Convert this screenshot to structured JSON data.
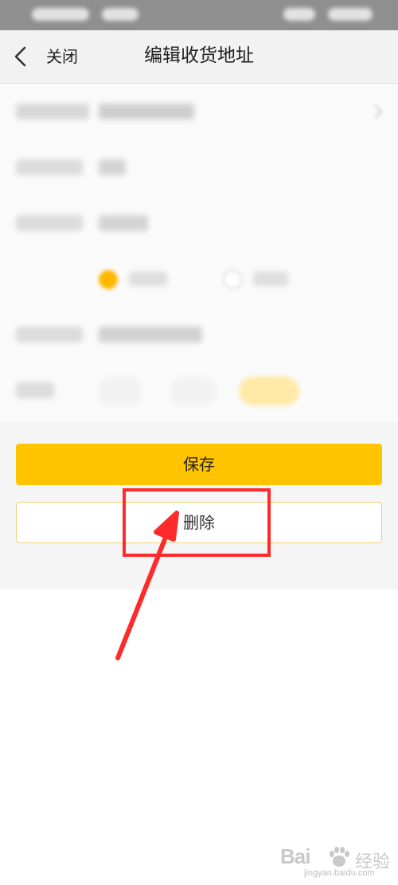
{
  "header": {
    "close_label": "关闭",
    "title": "编辑收货地址"
  },
  "actions": {
    "save_label": "保存",
    "delete_label": "删除"
  },
  "watermark": {
    "brand": "Bai",
    "name": "经验",
    "url": "jingyan.baidu.com"
  },
  "colors": {
    "accent": "#ffc400",
    "annotation": "#ff2a2a",
    "delete_border": "#f0d27a"
  },
  "icons": {
    "back": "chevron-left-icon",
    "annotation": "red-arrow-icon",
    "watermark": "baidu-paw-icon"
  }
}
